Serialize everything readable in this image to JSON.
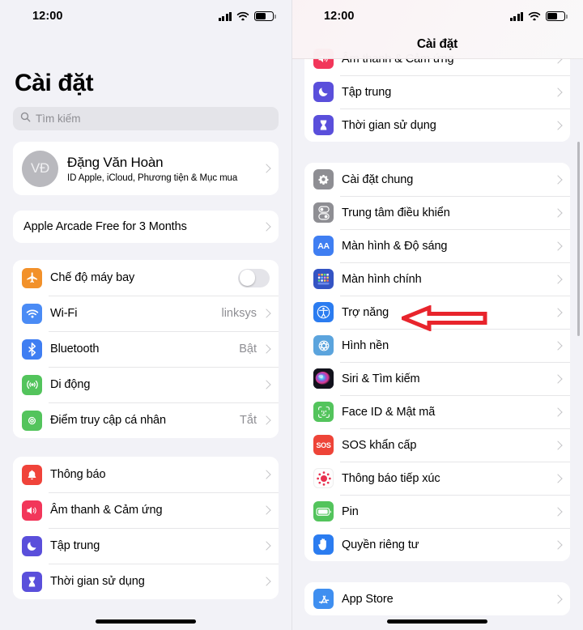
{
  "status_bar": {
    "time": "12:00",
    "signal_icon": "cellular-signal-icon",
    "wifi_icon": "wifi-icon",
    "battery_icon": "battery-icon"
  },
  "left_panel": {
    "title": "Cài đặt",
    "search": {
      "placeholder": "Tìm kiếm",
      "icon": "search-icon"
    },
    "profile": {
      "initials": "VĐ",
      "name": "Đặng Văn Hoàn",
      "subtitle": "ID Apple, iCloud, Phương tiện & Mục mua"
    },
    "promo": {
      "label": "Apple Arcade Free for 3 Months"
    },
    "group_connectivity": [
      {
        "label": "Chế độ máy bay",
        "icon": "airplane-icon",
        "color": "#f2912a",
        "control": "toggle",
        "toggle_on": false
      },
      {
        "label": "Wi-Fi",
        "icon": "wifi-icon",
        "color": "#4a8bf5",
        "value": "linksys"
      },
      {
        "label": "Bluetooth",
        "icon": "bluetooth-icon",
        "color": "#3f7ef2",
        "value": "Bật"
      },
      {
        "label": "Di động",
        "icon": "cellular-icon",
        "color": "#53c45c",
        "value": ""
      },
      {
        "label": "Điểm truy cập cá nhân",
        "icon": "hotspot-icon",
        "color": "#53c45c",
        "value": "Tắt"
      }
    ],
    "group_notifications": [
      {
        "label": "Thông báo",
        "icon": "bell-icon",
        "color": "#f0433a"
      },
      {
        "label": "Âm thanh & Cảm ứng",
        "icon": "speaker-icon",
        "color": "#f2365a"
      },
      {
        "label": "Tập trung",
        "icon": "moon-icon",
        "color": "#5a4fdb"
      },
      {
        "label": "Thời gian sử dụng",
        "icon": "hourglass-icon",
        "color": "#5a4fdb"
      }
    ]
  },
  "right_panel": {
    "nav_title": "Cài đặt",
    "group_partial_top": [
      {
        "label": "Âm thanh & Cảm ứng",
        "icon": "speaker-icon",
        "color": "#f2365a"
      },
      {
        "label": "Tập trung",
        "icon": "moon-icon",
        "color": "#5a4fdb"
      },
      {
        "label": "Thời gian sử dụng",
        "icon": "hourglass-icon",
        "color": "#5a4fdb"
      }
    ],
    "group_system": [
      {
        "label": "Cài đặt chung",
        "icon": "gear-icon",
        "color": "#8e8e93"
      },
      {
        "label": "Trung tâm điều khiển",
        "icon": "control-center-icon",
        "color": "#8e8e93"
      },
      {
        "label": "Màn hình & Độ sáng",
        "icon": "display-brightness-icon",
        "color": "#3f7ef2"
      },
      {
        "label": "Màn hình chính",
        "icon": "home-screen-icon",
        "color": "#3454c4"
      },
      {
        "label": "Trợ năng",
        "icon": "accessibility-icon",
        "color": "#2b7cf0"
      },
      {
        "label": "Hình nền",
        "icon": "wallpaper-icon",
        "color": "#5ba4dd"
      },
      {
        "label": "Siri & Tìm kiếm",
        "icon": "siri-icon",
        "color": "#1a1a28"
      },
      {
        "label": "Face ID & Mật mã",
        "icon": "faceid-icon",
        "color": "#53c45c"
      },
      {
        "label": "SOS khẩn cấp",
        "icon": "sos-icon",
        "color": "#ee4438"
      },
      {
        "label": "Thông báo tiếp xúc",
        "icon": "exposure-notification-icon",
        "color": "#ffffff"
      },
      {
        "label": "Pin",
        "icon": "battery-icon",
        "color": "#53c45c"
      },
      {
        "label": "Quyền riêng tư",
        "icon": "privacy-hand-icon",
        "color": "#2b7cf0"
      }
    ],
    "group_store": [
      {
        "label": "App Store",
        "icon": "app-store-icon",
        "color": "#3f8ff0"
      }
    ]
  },
  "annotation": {
    "arrow": "red-left-arrow",
    "color": "#e8242c",
    "points_at": "Trợ năng"
  }
}
